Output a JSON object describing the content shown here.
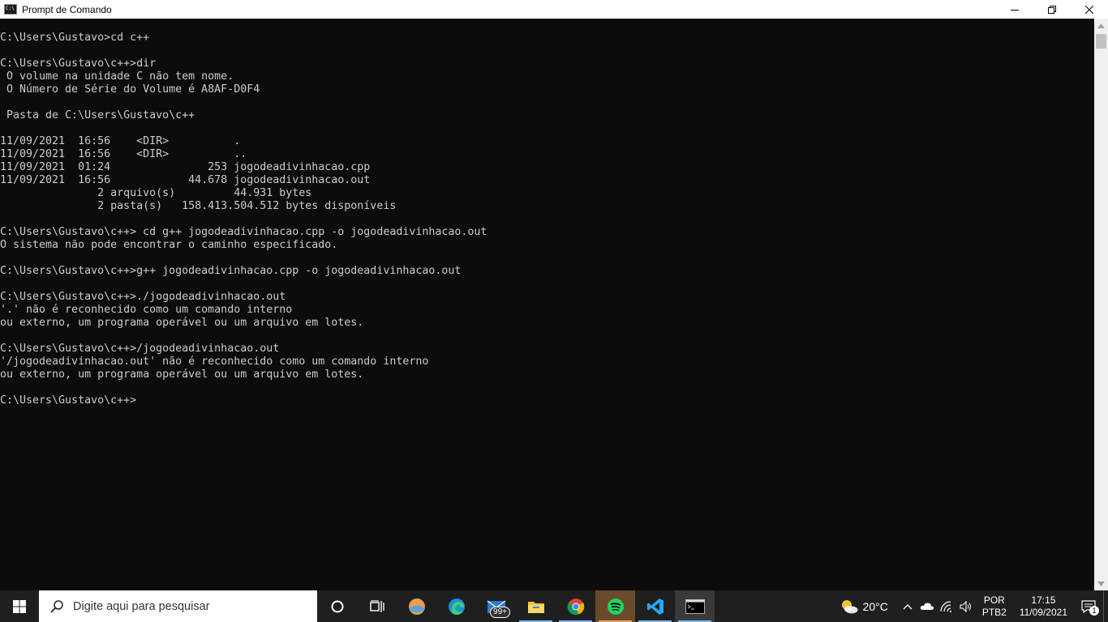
{
  "window": {
    "title": "Prompt de Comando",
    "app_icon_text": "C:\\",
    "buttons": [
      "minimize",
      "restore",
      "close"
    ]
  },
  "console": {
    "lines": [
      "C:\\Users\\Gustavo>cd c++",
      "",
      "C:\\Users\\Gustavo\\c++>dir",
      " O volume na unidade C não tem nome.",
      " O Número de Série do Volume é A8AF-D0F4",
      "",
      " Pasta de C:\\Users\\Gustavo\\c++",
      "",
      "11/09/2021  16:56    <DIR>          .",
      "11/09/2021  16:56    <DIR>          ..",
      "11/09/2021  01:24               253 jogodeadivinhacao.cpp",
      "11/09/2021  16:56            44.678 jogodeadivinhacao.out",
      "               2 arquivo(s)         44.931 bytes",
      "               2 pasta(s)   158.413.504.512 bytes disponíveis",
      "",
      "C:\\Users\\Gustavo\\c++> cd g++ jogodeadivinhacao.cpp -o jogodeadivinhacao.out",
      "O sistema não pode encontrar o caminho especificado.",
      "",
      "C:\\Users\\Gustavo\\c++>g++ jogodeadivinhacao.cpp -o jogodeadivinhacao.out",
      "",
      "C:\\Users\\Gustavo\\c++>./jogodeadivinhacao.out",
      "'.' não é reconhecido como um comando interno",
      "ou externo, um programa operável ou um arquivo em lotes.",
      "",
      "C:\\Users\\Gustavo\\c++>/jogodeadivinhacao.out",
      "'/jogodeadivinhacao.out' não é reconhecido como um comando interno",
      "ou externo, um programa operável ou um arquivo em lotes.",
      "",
      "C:\\Users\\Gustavo\\c++>"
    ]
  },
  "colors": {
    "console_bg": "#0c0c0c",
    "console_fg": "#cccccc",
    "taskbar_bg": "#1f1f1f"
  },
  "taskbar": {
    "search_placeholder": "Digite aqui para pesquisar",
    "apps": [
      {
        "icon": "task-view-icon"
      },
      {
        "icon": "widgets-icon"
      },
      {
        "icon": "orb-app-icon"
      },
      {
        "icon": "edge-icon"
      },
      {
        "icon": "mail-icon",
        "badge": "99+"
      },
      {
        "icon": "file-explorer-icon"
      },
      {
        "icon": "chrome-icon"
      },
      {
        "icon": "spotify-icon"
      },
      {
        "icon": "vscode-icon"
      },
      {
        "icon": "cmd-icon"
      }
    ],
    "tray": {
      "temperature": "20°C",
      "lang_line1": "POR",
      "lang_line2": "PTB2",
      "time": "17:15",
      "date": "11/09/2021",
      "notifications": "1"
    }
  }
}
